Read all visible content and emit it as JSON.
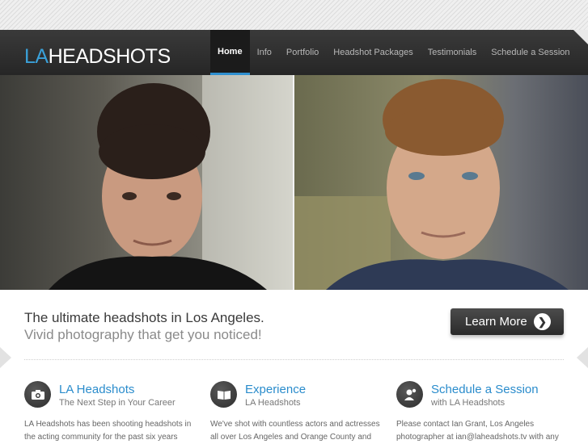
{
  "logo": {
    "accent": "LA",
    "rest": "HEADSHOTS"
  },
  "nav": [
    "Home",
    "Info",
    "Portfolio",
    "Headshot Packages",
    "Testimonials",
    "Schedule a Session"
  ],
  "hero": {
    "left_alt": "",
    "right_alt": ""
  },
  "tagline": {
    "line1": "The ultimate headshots in Los Angeles.",
    "line2": "Vivid photography that get you noticed!"
  },
  "cta": {
    "label": "Learn More",
    "arrow": "❯"
  },
  "columns": [
    {
      "icon": "camera-icon",
      "title": "LA Headshots",
      "subtitle": "The Next Step in Your Career",
      "body": "LA Headshots has been shooting headshots in the acting community for the past six years"
    },
    {
      "icon": "book-icon",
      "title": "Experience",
      "subtitle": "LA Headshots",
      "body": "We've shot with countless actors and actresses all over Los Angeles and Orange County and"
    },
    {
      "icon": "person-icon",
      "title": "Schedule a Session",
      "subtitle": "with LA Headshots",
      "body": "Please contact Ian Grant, Los Angeles photographer at ian@laheadshots.tv with any"
    }
  ],
  "colors": {
    "accent": "#3aa0d8",
    "header": "#2e2e2e",
    "button": "#3a3a3a"
  }
}
